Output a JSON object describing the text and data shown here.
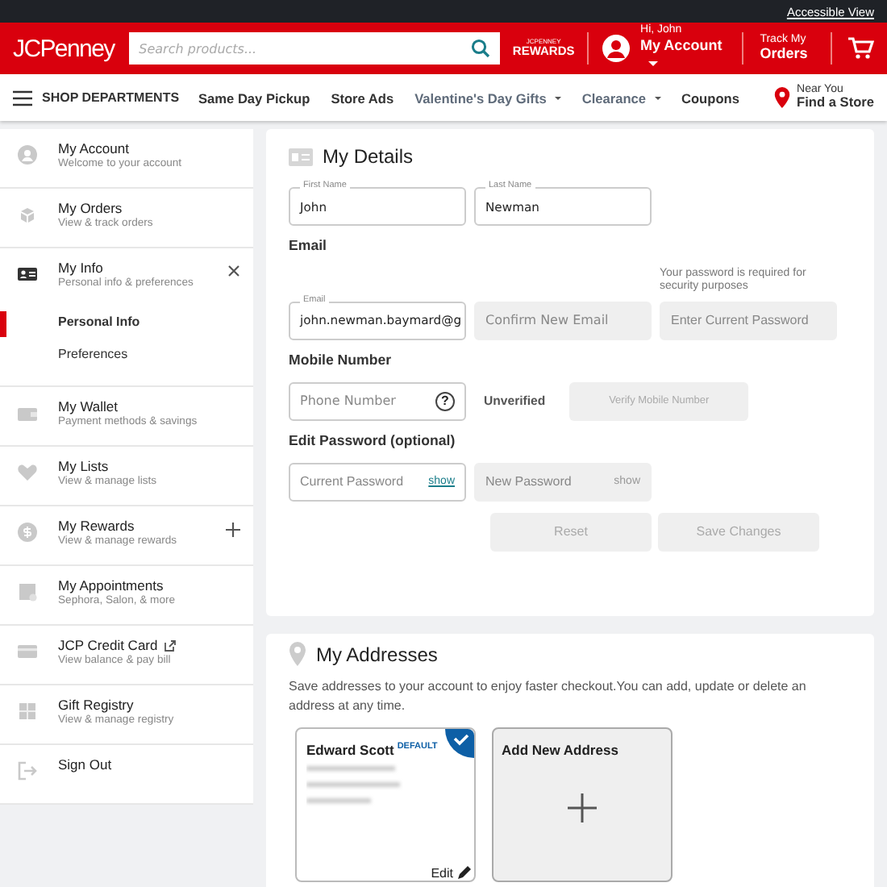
{
  "top_bar": {
    "link": "Accessible View"
  },
  "header": {
    "logo": "JCPenney",
    "search": {
      "placeholder": "Search products..."
    },
    "rewards": {
      "line_1": "JCPENNEY",
      "line_2": "REWARDS"
    },
    "account": {
      "greeting": "Hi, John",
      "label": "My Account"
    },
    "orders": {
      "line_1": "Track My",
      "line_2": "Orders"
    }
  },
  "nav": {
    "menu_label": "SHOP DEPARTMENTS",
    "links": [
      {
        "label": "Same Day Pickup",
        "kind": "link"
      },
      {
        "label": "Store Ads",
        "kind": "link"
      },
      {
        "label": "Valentine's Day Gifts",
        "kind": "menu"
      },
      {
        "label": "Clearance",
        "kind": "menu"
      },
      {
        "label": "Coupons",
        "kind": "link"
      }
    ],
    "store": {
      "line_1": "Near You",
      "line_2": "Find a Store"
    }
  },
  "sidebar": {
    "items": [
      {
        "title": "My Account",
        "subtitle": "Welcome to your account"
      },
      {
        "title": "My Orders",
        "subtitle": "View & track orders"
      },
      {
        "title": "My Info",
        "subtitle": "Personal info & preferences",
        "expanded": true,
        "children": [
          {
            "label": "Personal Info",
            "selected": true
          },
          {
            "label": "Preferences",
            "selected": false
          }
        ]
      },
      {
        "title": "My Wallet",
        "subtitle": "Payment methods & savings"
      },
      {
        "title": "My Lists",
        "subtitle": "View & manage lists"
      },
      {
        "title": "My Rewards",
        "subtitle": "View & manage rewards",
        "expanded": false
      },
      {
        "title": "My Appointments",
        "subtitle": "Sephora, Salon, & more"
      },
      {
        "title": "JCP Credit Card",
        "subtitle": "View balance & pay bill",
        "external": true
      },
      {
        "title": "Gift Registry",
        "subtitle": "View & manage registry"
      },
      {
        "title": "Sign Out"
      }
    ]
  },
  "details": {
    "title": "My Details",
    "name_fields": [
      {
        "label": "First Name",
        "value": "John",
        "disabled": false
      },
      {
        "label": "Last Name",
        "value": "Newman",
        "disabled": false
      }
    ],
    "email_heading": "Email",
    "email_fields": [
      {
        "label": "Email",
        "value": "john.newman.baymard@g",
        "disabled": false
      },
      {
        "placeholder": "Confirm New Email",
        "disabled": true
      }
    ],
    "password_note": "Your password is required for security purposes",
    "current_password_field": {
      "placeholder": "Enter Current Password",
      "disabled": true
    },
    "mobile_heading": "Mobile Number",
    "phone_field": {
      "placeholder": "Phone Number",
      "help": "?",
      "disabled": false
    },
    "phone_status": "Unverified",
    "verify_button": {
      "label": "Verify Mobile Number",
      "disabled": true
    },
    "password_heading": "Edit Password (optional)",
    "password_fields": [
      {
        "placeholder": "Current Password",
        "toggle": "show",
        "disabled": false
      },
      {
        "placeholder": "New Password",
        "toggle": "show",
        "disabled": true
      }
    ],
    "buttons": [
      {
        "label": "Reset",
        "disabled": true
      },
      {
        "label": "Save Changes",
        "disabled": true
      }
    ]
  },
  "addresses": {
    "title": "My Addresses",
    "description": "Save addresses to your account to enjoy faster checkout.You can add, update or delete an address at any time.",
    "cards": [
      {
        "name": "Edward Scott",
        "badge": "DEFAULT",
        "selected": true,
        "edit": "Edit"
      }
    ],
    "add_card": {
      "label": "Add New Address"
    }
  }
}
